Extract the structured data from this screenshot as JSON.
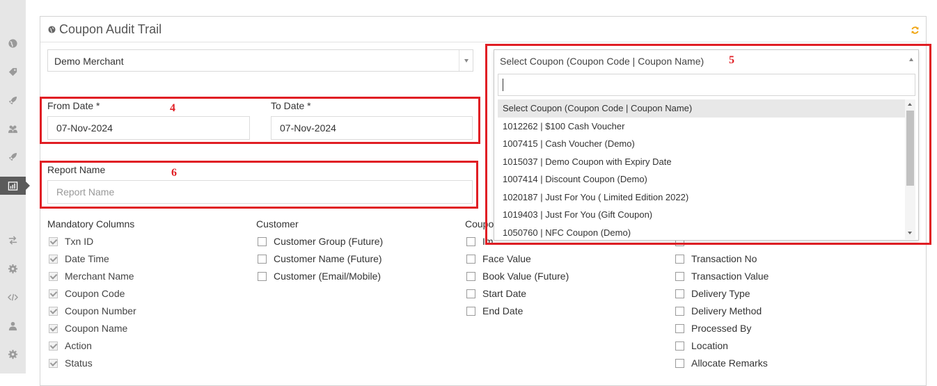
{
  "sidebar": {
    "icons": [
      "globe-icon",
      "tag-icon",
      "rocket-icon",
      "users-icon",
      "rocket-alt-icon",
      "bar-chart-icon",
      "exchange-icon",
      "gear-icon",
      "code-icon",
      "user-icon",
      "settings-icon"
    ],
    "active": "bar-chart-icon"
  },
  "panel": {
    "title": "Coupon Audit Trail",
    "refresh_icon_color": "#f0a30a"
  },
  "merchant": {
    "value": "Demo Merchant"
  },
  "dates": {
    "from_label": "From Date *",
    "from_value": "07-Nov-2024",
    "to_label": "To Date *",
    "to_value": "07-Nov-2024"
  },
  "report": {
    "label": "Report Name",
    "placeholder": "Report Name"
  },
  "annotations": {
    "dates": "4",
    "coupon": "5",
    "report": "6",
    "color": "#e01e24"
  },
  "columns": {
    "mandatory": {
      "heading": "Mandatory Columns",
      "items": [
        "Txn ID",
        "Date Time",
        "Merchant Name",
        "Coupon Code",
        "Coupon Number",
        "Coupon Name",
        "Action",
        "Status"
      ]
    },
    "customer": {
      "heading": "Customer",
      "items": [
        "Customer Group (Future)",
        "Customer Name (Future)",
        "Customer (Email/Mobile)"
      ]
    },
    "coupon": {
      "heading_partial": "Coupo",
      "first_partial": "Im",
      "items": [
        "Face Value",
        "Book Value (Future)",
        "Start Date",
        "End Date"
      ]
    },
    "transaction": {
      "items": [
        "Transaction No",
        "Transaction Value",
        "Delivery Type",
        "Delivery Method",
        "Processed By",
        "Location",
        "Allocate Remarks"
      ]
    }
  },
  "coupon_select": {
    "selected": "Select Coupon (Coupon Code | Coupon Name)",
    "options": [
      "Select Coupon (Coupon Code | Coupon Name)",
      "1012262 | $100 Cash Voucher",
      "1007415 | Cash Voucher (Demo)",
      "1015037 | Demo Coupon with Expiry Date",
      "1007414 | Discount Coupon (Demo)",
      "1020187 | Just For You ( Limited Edition 2022)",
      "1019403 | Just For You (Gift Coupon)",
      "1050760 | NFC Coupon (Demo)"
    ]
  }
}
